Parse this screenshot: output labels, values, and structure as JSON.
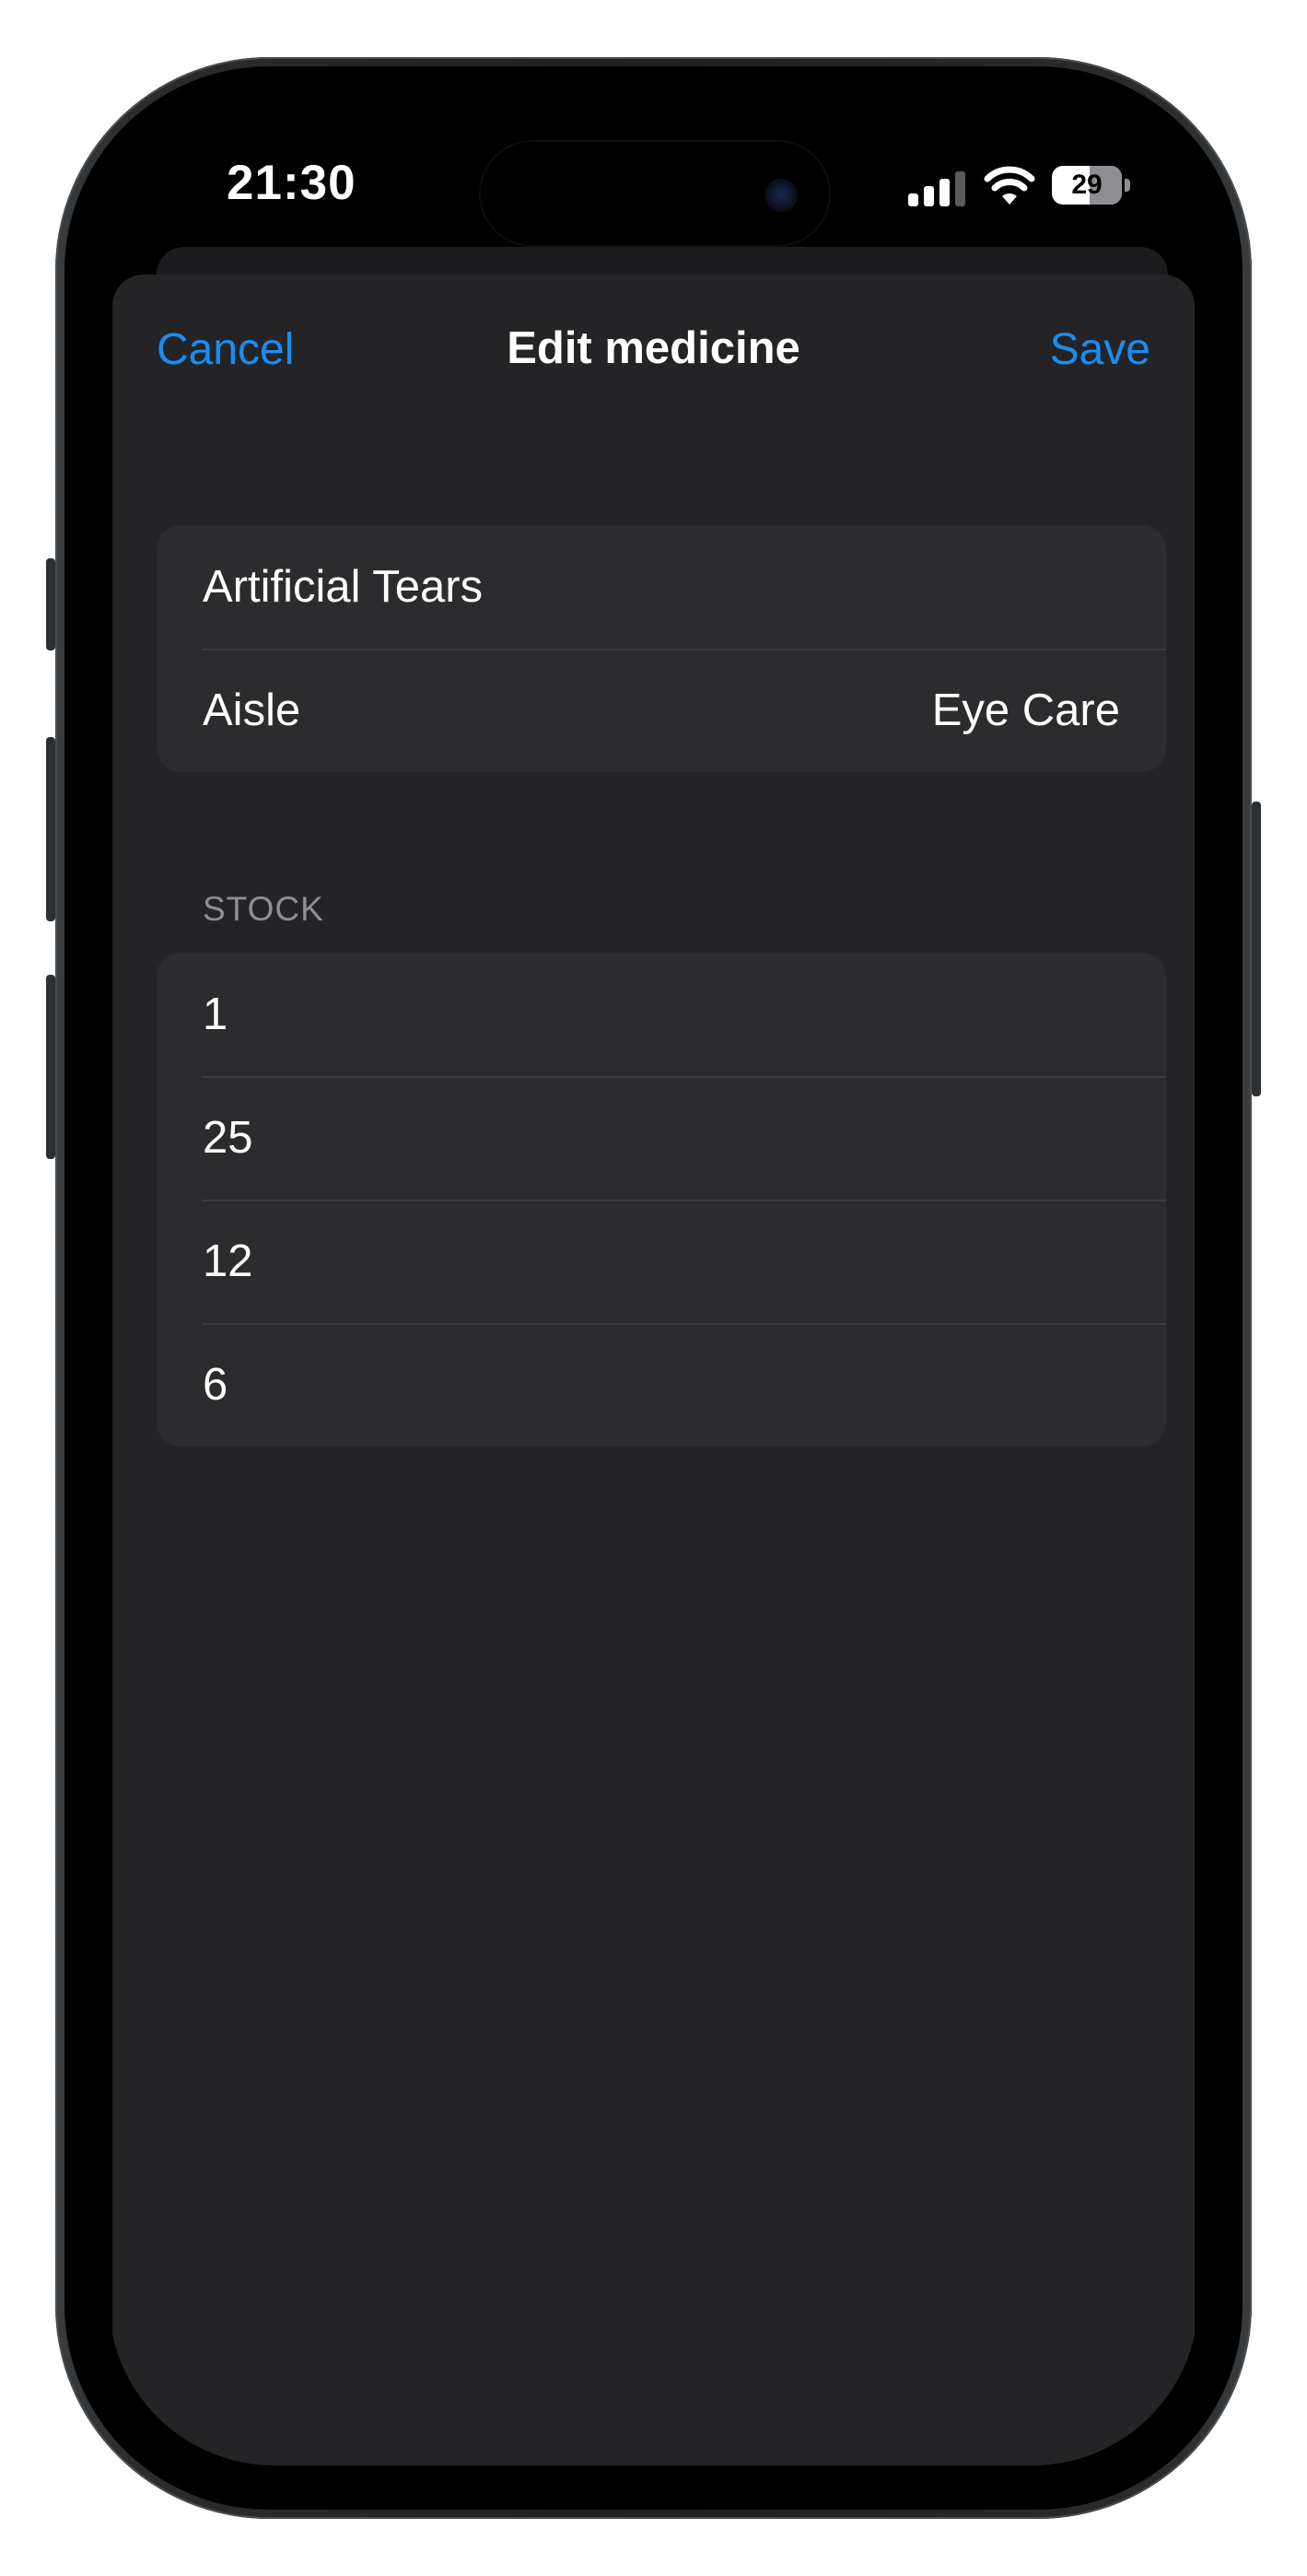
{
  "status_bar": {
    "time": "21:30",
    "signal_icon": "cellular-signal-icon",
    "wifi_icon": "wifi-icon",
    "battery_level": "29"
  },
  "nav": {
    "cancel_label": "Cancel",
    "title": "Edit medicine",
    "save_label": "Save"
  },
  "details": {
    "name_value": "Artificial Tears",
    "aisle_label": "Aisle",
    "aisle_value": "Eye Care"
  },
  "stock": {
    "header": "STOCK",
    "items": [
      "1",
      "25",
      "12",
      "6"
    ]
  },
  "colors": {
    "accent": "#1a8df2",
    "sheet_background": "#242426",
    "group_background": "#2c2c2e",
    "secondary_text": "#8e8e93"
  }
}
